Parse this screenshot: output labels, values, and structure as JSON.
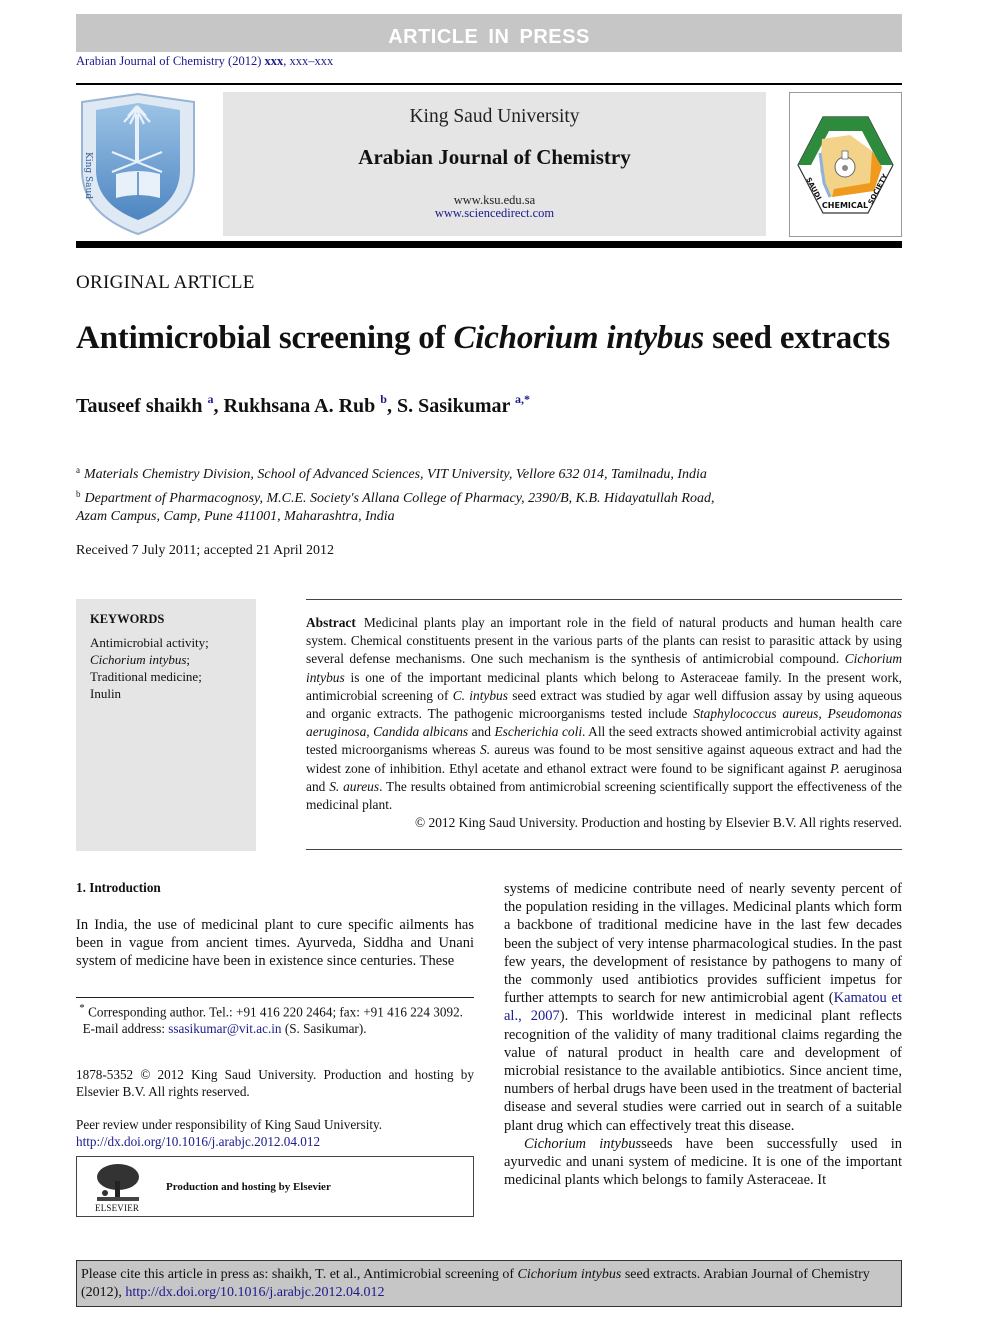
{
  "banner": {
    "text": "ARTICLE IN PRESS"
  },
  "running_head": {
    "journal": "Arabian Journal of Chemistry (2012)",
    "volume": "xxx",
    "pages": ", xxx–xxx"
  },
  "masthead": {
    "university": "King Saud University",
    "journal": "Arabian Journal of Chemistry",
    "url_ksu": "www.ksu.edu.sa",
    "url_sd": "www.sciencedirect.com",
    "left_logo": "king-saud-university-logo",
    "right_logo": "saudi-chemical-society-logo",
    "right_logo_label": "CHEMICAL",
    "right_logo_left": "SAUDI",
    "right_logo_right": "SOCIETY"
  },
  "article_type": "ORIGINAL ARTICLE",
  "title": {
    "pre": "Antimicrobial screening of ",
    "italic": "Cichorium intybus",
    "post": " seed extracts"
  },
  "authors": [
    {
      "name": "Tauseef shaikh",
      "sup": "a"
    },
    {
      "name": "Rukhsana A. Rub",
      "sup": "b"
    },
    {
      "name": "S. Sasikumar",
      "sup": "a,*"
    }
  ],
  "affiliations": [
    {
      "mark": "a",
      "text": "Materials Chemistry Division, School of Advanced Sciences, VIT University, Vellore 632 014, Tamilnadu, India"
    },
    {
      "mark": "b",
      "text": "Department of Pharmacognosy, M.C.E. Society's Allana College of Pharmacy, 2390/B, K.B. Hidayatullah Road,",
      "cont": "Azam Campus, Camp, Pune 411001, Maharashtra, India"
    }
  ],
  "received": "Received 7 July 2011; accepted 21 April 2012",
  "keywords": {
    "title": "KEYWORDS",
    "items": [
      "Antimicrobial activity;",
      "Cichorium intybus",
      ";",
      "Traditional medicine;",
      "Inulin"
    ]
  },
  "abstract": {
    "heading": "Abstract",
    "p1": "Medicinal plants play an important role in the field of natural products and human health care system. Chemical constituents present in the various parts of the plants can resist to parasitic attack by using several defense mechanisms. One such mechanism is the synthesis of antimicrobial compound. ",
    "i1": "Cichorium intybus",
    "p2": " is one of the important medicinal plants which belong to Asteraceae family. In the present work, antimicrobial screening of ",
    "i2": "C. intybus",
    "p3": " seed extract was studied by agar well diffusion assay by using aqueous and organic extracts. The pathogenic microorganisms tested include ",
    "i3": "Staphylococcus aureus, Pseudomonas aeruginosa, Candida albicans",
    "p4": " and ",
    "i4": "Escherichia coli",
    "p5": ". All the seed extracts showed antimicrobial activity against tested microorganisms whereas ",
    "i5": "S.",
    "p6": " aureus was found to be most sensitive against aqueous extract and had the widest zone of inhibition. Ethyl acetate and ethanol extract were found to be significant against ",
    "i6": "P.",
    "p7": " aeruginosa and ",
    "i7": "S. aureus",
    "p8": ". The results obtained from antimicrobial screening scientifically support the effectiveness of the medicinal plant.",
    "copyright": "© 2012 King Saud University. Production and hosting by Elsevier B.V. All rights reserved."
  },
  "introduction": {
    "heading": "1. Introduction",
    "left_para": "In India, the use of medicinal plant to cure specific ailments has been in vague from ancient times. Ayurveda, Siddha and Unani system of medicine have been in existence since centuries. These",
    "right_p1a": "systems of medicine contribute need of nearly seventy percent of the population residing in the villages. Medicinal plants which form a backbone of traditional medicine have in the last few decades been the subject of very intense pharmacological studies. In the past few years, the development of resistance by pathogens to many of the commonly used antibiotics provides sufficient impetus for further attempts to search for new antimicrobial agent (",
    "right_ref": "Kamatou et al., 2007",
    "right_p1b": "). This worldwide interest in medicinal plant reflects recognition of the validity of many traditional claims regarding the value of natural product in health care and development of microbial resistance to the available antibiotics. Since ancient time, numbers of herbal drugs have been used in the treatment of bacterial disease and several studies were carried out in search of a suitable plant drug which can effectively treat this disease.",
    "right_p2_italic": "Cichorium intybus",
    "right_p2": "seeds have been successfully used in ayurvedic and unani system of medicine. It is one of the important medicinal plants which belongs to family Asteraceae. It"
  },
  "footnotes": {
    "corresponding": "Corresponding author. Tel.: +91 416 220 2464; fax: +91 416 224 3092.",
    "email_label": "E-mail address: ",
    "email": "ssasikumar@vit.ac.in",
    "email_owner": " (S. Sasikumar).",
    "issn": "1878-5352 © 2012 King Saud University. Production and hosting by Elsevier B.V. All rights reserved.",
    "peer_review": "Peer review under responsibility of King Saud University.",
    "doi": "http://dx.doi.org/10.1016/j.arabjc.2012.04.012"
  },
  "elsevier": {
    "word": "ELSEVIER",
    "caption": "Production and hosting by Elsevier"
  },
  "citation": {
    "pre": "Please cite this article in press as: shaikh, T. et al., Antimicrobial screening of ",
    "italic": "Cichorium intybus",
    "post": " seed extracts. Arabian Journal of Chemistry (2012), ",
    "doi": "http://dx.doi.org/10.1016/j.arabjc.2012.04.012"
  }
}
